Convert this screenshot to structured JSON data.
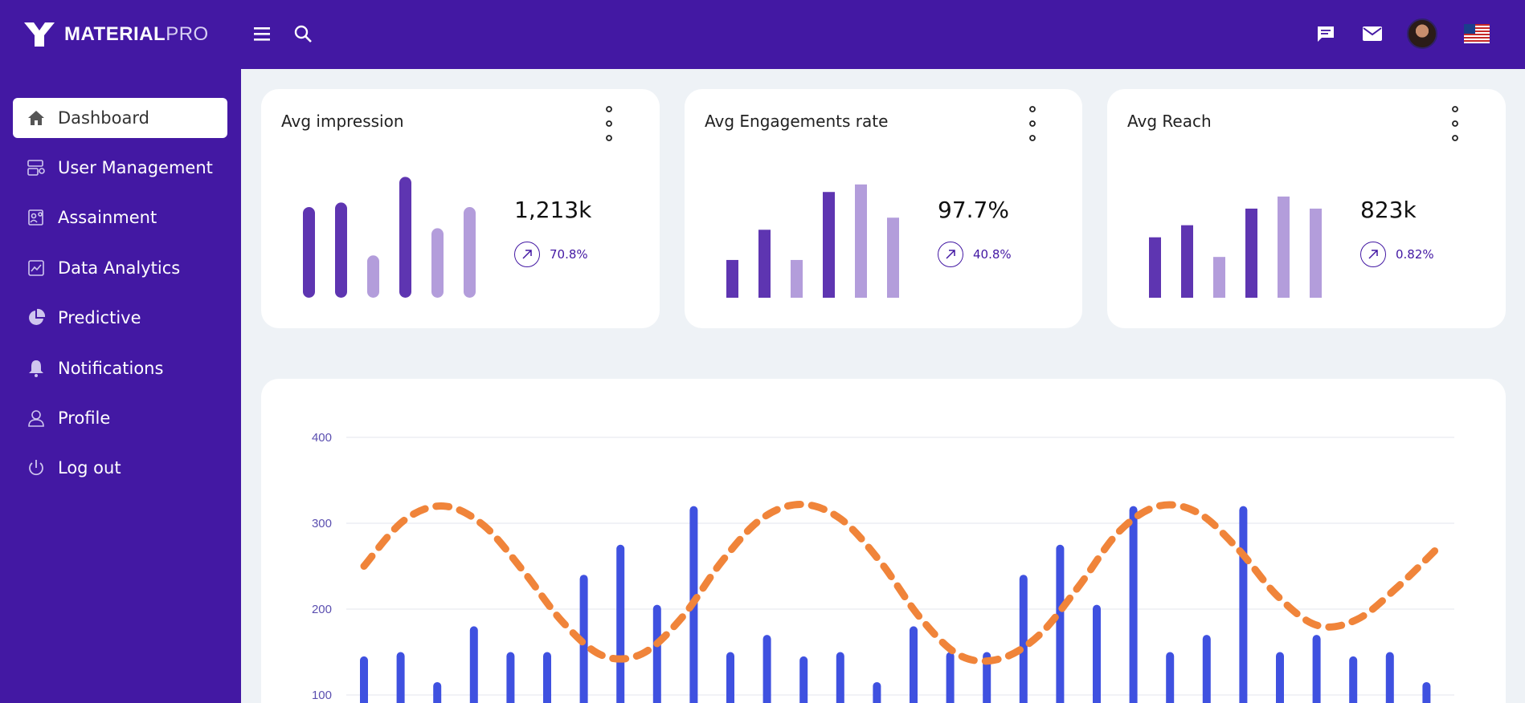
{
  "brand": {
    "name_bold": "MATERIAL",
    "name_light": "PRO"
  },
  "topbar": {
    "icons": [
      "menu-icon",
      "search-icon",
      "chat-icon",
      "mail-icon"
    ],
    "avatar": "user-avatar",
    "flag": "us-flag-icon"
  },
  "sidebar": {
    "items": [
      {
        "label": "Dashboard",
        "icon": "home-icon",
        "active": true
      },
      {
        "label": "User Management",
        "icon": "user-management-icon"
      },
      {
        "label": "Assainment",
        "icon": "assignment-icon"
      },
      {
        "label": "Data Analytics",
        "icon": "analytics-icon"
      },
      {
        "label": "Predictive",
        "icon": "pie-chart-icon"
      },
      {
        "label": "Notifications",
        "icon": "bell-icon"
      },
      {
        "label": "Profile",
        "icon": "profile-icon"
      },
      {
        "label": "Log out",
        "icon": "power-icon"
      }
    ]
  },
  "stats": [
    {
      "title": "Avg impression",
      "value": "1,213k",
      "change": "70.8%"
    },
    {
      "title": "Avg Engagements rate",
      "value": "97.7%",
      "change": "40.8%"
    },
    {
      "title": "Avg Reach",
      "value": "823k",
      "change": "0.82%"
    }
  ],
  "colors": {
    "primary": "#4318a3",
    "bar_dark": "#5e35b1",
    "bar_light": "#b39ddb",
    "chart_bar": "#3f51e0",
    "chart_line": "#f0843a"
  },
  "chart_data": [
    {
      "type": "bar",
      "values": [
        6,
        6.3,
        2.8,
        8,
        4.6,
        6
      ],
      "ylim": [
        0,
        8.5
      ],
      "colors": [
        "dark",
        "dark",
        "light",
        "dark",
        "light",
        "light"
      ],
      "rounded": true
    },
    {
      "type": "bar",
      "values": [
        2.5,
        4.5,
        2.5,
        7,
        7.5,
        5.3
      ],
      "ylim": [
        0,
        8.5
      ],
      "colors": [
        "dark",
        "dark",
        "light",
        "dark",
        "light",
        "light"
      ],
      "rounded": false
    },
    {
      "type": "bar",
      "values": [
        4,
        4.8,
        2.7,
        5.9,
        6.7,
        5.9
      ],
      "ylim": [
        0,
        8.5
      ],
      "colors": [
        "dark",
        "dark",
        "light",
        "dark",
        "light",
        "light"
      ],
      "rounded": false
    },
    {
      "type": "bar+line",
      "yticks": [
        100,
        200,
        300,
        400
      ],
      "ylim": [
        100,
        400
      ],
      "grid": true,
      "series": [
        {
          "type": "bar",
          "values": [
            145,
            150,
            115,
            180,
            150,
            150,
            240,
            275,
            205,
            320,
            150,
            170,
            145,
            150,
            115,
            180,
            150,
            150,
            240,
            275,
            205,
            320,
            150,
            170,
            320,
            150,
            170,
            145,
            150,
            115
          ]
        },
        {
          "type": "line",
          "dashed": true,
          "values": [
            250,
            303,
            320,
            298,
            245,
            185,
            146,
            148,
            190,
            255,
            305,
            322,
            305,
            255,
            190,
            146,
            142,
            170,
            227,
            290,
            320,
            312,
            270,
            215,
            181,
            188,
            225,
            270
          ]
        }
      ]
    }
  ]
}
